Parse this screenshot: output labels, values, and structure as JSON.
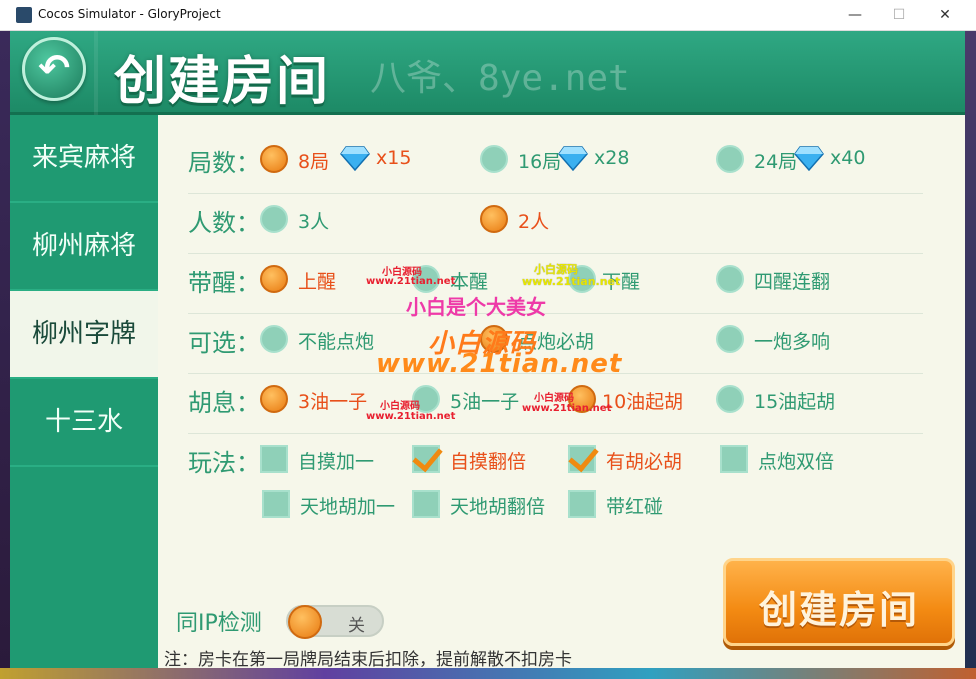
{
  "window": {
    "title": "Cocos Simulator - GloryProject",
    "minimize": "—",
    "maximize": "☐",
    "close": "✕"
  },
  "header": {
    "title": "创建房间",
    "watermark": "八爷、8ye.net",
    "back_icon": "back-arrow-icon"
  },
  "sidebar": {
    "items": [
      {
        "label": "来宾麻将",
        "active": false
      },
      {
        "label": "柳州麻将",
        "active": false
      },
      {
        "label": "柳州字牌",
        "active": true
      },
      {
        "label": "十三水",
        "active": false
      }
    ]
  },
  "rounds": {
    "label": "局数：",
    "options": [
      {
        "label": "8局",
        "gems": "x15",
        "selected": true
      },
      {
        "label": "16局",
        "gems": "x28",
        "selected": false
      },
      {
        "label": "24局",
        "gems": "x40",
        "selected": false
      }
    ]
  },
  "players": {
    "label": "人数：",
    "options": [
      {
        "label": "3人",
        "selected": false
      },
      {
        "label": "2人",
        "selected": true
      }
    ]
  },
  "xing": {
    "label": "带醒：",
    "options": [
      {
        "label": "上醒",
        "selected": true
      },
      {
        "label": "本醒",
        "selected": false
      },
      {
        "label": "下醒",
        "selected": false
      },
      {
        "label": "四醒连翻",
        "selected": false
      }
    ]
  },
  "optional": {
    "label": "可选：",
    "options": [
      {
        "label": "不能点炮",
        "selected": false
      },
      {
        "label": "点炮必胡",
        "selected": true
      },
      {
        "label": "一炮多响",
        "selected": false
      }
    ]
  },
  "huxi": {
    "label": "胡息：",
    "options": [
      {
        "label": "3油一子",
        "selected": true
      },
      {
        "label": "5油一子",
        "selected": false
      },
      {
        "label": "10油起胡",
        "selected": true
      },
      {
        "label": "15油起胡",
        "selected": false
      }
    ]
  },
  "rules": {
    "label": "玩法：",
    "options": [
      {
        "label": "自摸加一",
        "checked": false
      },
      {
        "label": "自摸翻倍",
        "checked": true
      },
      {
        "label": "有胡必胡",
        "checked": true
      },
      {
        "label": "点炮双倍",
        "checked": false
      },
      {
        "label": "天地胡加一",
        "checked": false
      },
      {
        "label": "天地胡翻倍",
        "checked": false
      },
      {
        "label": "带红碰",
        "checked": false
      }
    ]
  },
  "watermarks": {
    "red1": "小白源码",
    "red1_url": "www.21tian.net",
    "yellow1": "小白源码",
    "yellow1_url": "www.21tian.net",
    "pink": "小白是个大美女",
    "big_cn": "小白源码",
    "big_url": "www.21tian.net",
    "red2": "小白源码",
    "red2_url": "www.21tian.net",
    "red3": "小白源码",
    "red3_url": "www.21tian.net"
  },
  "same_ip": {
    "label": "同IP检测",
    "state": "关",
    "enabled": false
  },
  "note": "注：房卡在第一局牌局结束后扣除，提前解散不扣房卡",
  "create_button": "创建房间",
  "colors": {
    "header_green": "#2fa883",
    "sidebar_green": "#1f9a72",
    "panel_bg": "#f6f7ea",
    "text_green": "#2f9a72",
    "selected_orange": "#e8501a",
    "button_orange": "#f38a12"
  }
}
